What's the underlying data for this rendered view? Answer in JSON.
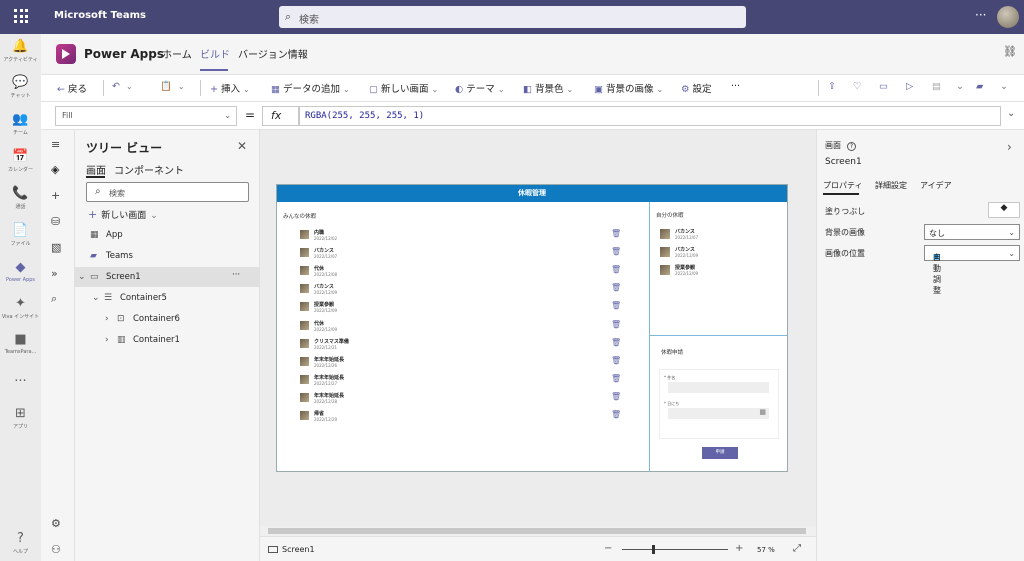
{
  "topbar": {
    "title": "Microsoft Teams",
    "search_placeholder": "検索",
    "more": "···"
  },
  "rail": [
    {
      "name": "rail-activity",
      "glyph": "🔔",
      "label": "アクティビティ"
    },
    {
      "name": "rail-chat",
      "glyph": "💬",
      "label": "チャット"
    },
    {
      "name": "rail-teams",
      "glyph": "👥",
      "label": "チーム"
    },
    {
      "name": "rail-calendar",
      "glyph": "📅",
      "label": "カレンダー"
    },
    {
      "name": "rail-calls",
      "glyph": "📞",
      "label": "通話"
    },
    {
      "name": "rail-files",
      "glyph": "📄",
      "label": "ファイル"
    },
    {
      "name": "rail-powerapps",
      "glyph": "◆",
      "label": "Power Apps"
    },
    {
      "name": "rail-viva",
      "glyph": "✦",
      "label": "Viva インサイト"
    },
    {
      "name": "rail-teamspara",
      "glyph": "■",
      "label": "TeamsPara..."
    },
    {
      "name": "rail-more",
      "glyph": "···",
      "label": ""
    },
    {
      "name": "rail-apps",
      "glyph": "⊞",
      "label": "アプリ"
    },
    {
      "name": "rail-help",
      "glyph": "?",
      "label": "ヘルプ"
    }
  ],
  "header": {
    "app_title": "Power Apps",
    "tabs": [
      "ホーム",
      "ビルド",
      "バージョン情報"
    ]
  },
  "toolbar": {
    "back": "戻る",
    "insert": "挿入",
    "add_data": "データの追加",
    "new_screen": "新しい画面",
    "theme": "テーマ",
    "bg_color": "背景色",
    "bg_image": "背景の画像",
    "settings": "設定",
    "more": "···"
  },
  "formula": {
    "property": "Fill",
    "eq": "=",
    "fx": "fx",
    "value": "RGBA(255, 255, 255, 1)"
  },
  "tree": {
    "title": "ツリー ビュー",
    "tab_screens": "画面",
    "tab_components": "コンポーネント",
    "search_placeholder": "検索",
    "new_screen": "新しい画面",
    "nodes": [
      "App",
      "Teams",
      "Screen1",
      "Container5",
      "Container6",
      "Container1"
    ],
    "node_more": "···"
  },
  "app": {
    "header": "休暇管理",
    "all_title": "みんなの休暇",
    "mine_title": "自分の休暇",
    "request_title": "休暇申請",
    "all_rows": [
      {
        "title": "内職",
        "date": "2022/12/02"
      },
      {
        "title": "バカンス",
        "date": "2022/12/07"
      },
      {
        "title": "代休",
        "date": "2022/12/08"
      },
      {
        "title": "バカンス",
        "date": "2022/12/09"
      },
      {
        "title": "授業参観",
        "date": "2022/12/09"
      },
      {
        "title": "代休",
        "date": "2022/12/09"
      },
      {
        "title": "クリスマス準備",
        "date": "2022/12/21"
      },
      {
        "title": "年末年始延長",
        "date": "2022/12/26"
      },
      {
        "title": "年末年始延長",
        "date": "2022/12/27"
      },
      {
        "title": "年末年始延長",
        "date": "2022/12/28"
      },
      {
        "title": "帰省",
        "date": "2022/12/29"
      }
    ],
    "my_rows": [
      {
        "title": "バカンス",
        "date": "2022/12/07"
      },
      {
        "title": "バカンス",
        "date": "2022/12/09"
      },
      {
        "title": "授業参観",
        "date": "2022/12/09"
      }
    ],
    "form_subject": "* 件名",
    "form_date": "* 日にち",
    "submit": "申請"
  },
  "status": {
    "screen": "Screen1",
    "zoom": "57",
    "percent": "%",
    "minus": "−",
    "plus": "+"
  },
  "props": {
    "section": "画面",
    "screen_name": "Screen1",
    "tabs": [
      "プロパティ",
      "詳細設定",
      "アイデア"
    ],
    "fill_label": "塗りつぶし",
    "bg_image_label": "背景の画像",
    "bg_image_value": "なし",
    "image_pos_label": "画像の位置",
    "image_pos_value": "自動調整"
  },
  "colors": {
    "teams_purple": "#464775",
    "accent": "#6264a7",
    "app_header": "#0f7ac0"
  }
}
